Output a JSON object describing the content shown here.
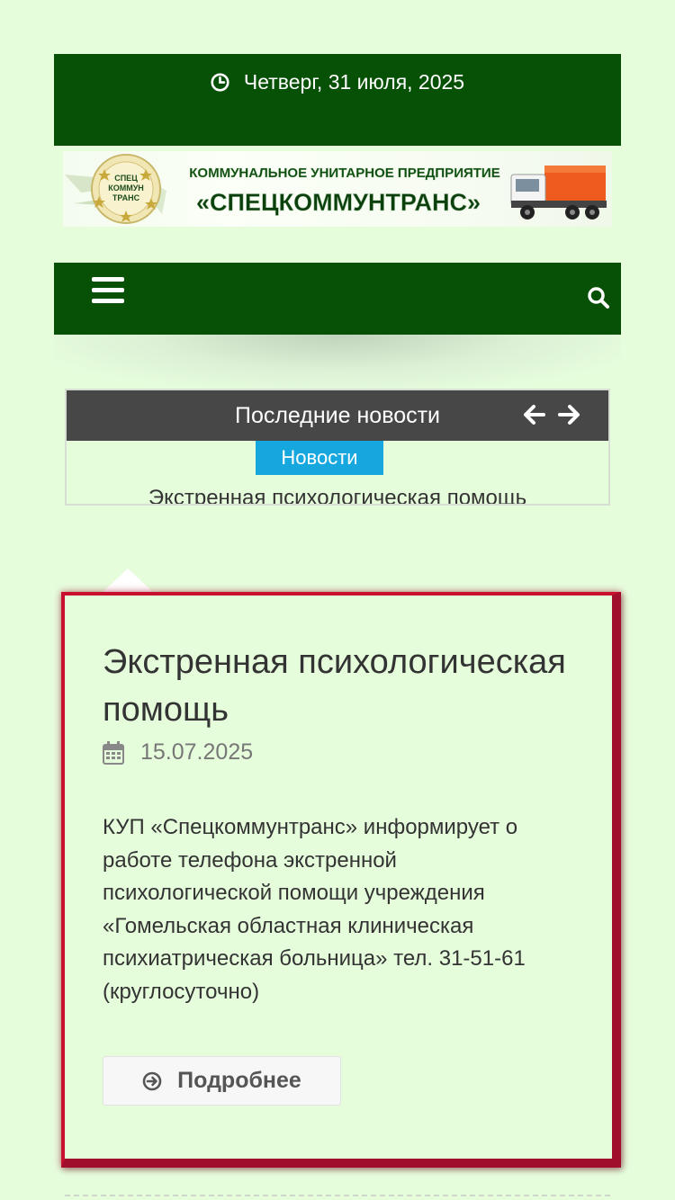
{
  "topbar": {
    "date": "Четверг, 31 июля, 2025"
  },
  "banner": {
    "logo_text_1": "СПЕЦ",
    "logo_text_2": "КОММУН",
    "logo_text_3": "ТРАНС",
    "line1": "КОММУНАЛЬНОЕ УНИТАРНОЕ ПРЕДПРИЯТИЕ",
    "line2": "«СПЕЦКОММУНТРАНС»"
  },
  "ticker": {
    "title": "Последние новости",
    "category": "Новости",
    "item": "Экстренная психологическая помощь"
  },
  "article": {
    "title": "Экстренная психологическая помощь",
    "date": "15.07.2025",
    "text": "КУП «Спецкоммунтранс» информирует о работе телефона экстренной психологической помощи учреждения «Гомельская областная клиническая психиатрическая больница» тел. 31-51-61 (круглосуточно)",
    "more_label": "Подробнее"
  },
  "colors": {
    "page_bg": "#e6fddc",
    "bar_green": "#065106",
    "ticker_dark": "#474747",
    "badge_blue": "#16a7df",
    "card_border": "#a00f2c"
  },
  "icons": [
    "clock-icon",
    "menu-icon",
    "search-icon",
    "arrow-left-icon",
    "arrow-right-icon",
    "calendar-icon",
    "arrow-circle-right-icon"
  ]
}
